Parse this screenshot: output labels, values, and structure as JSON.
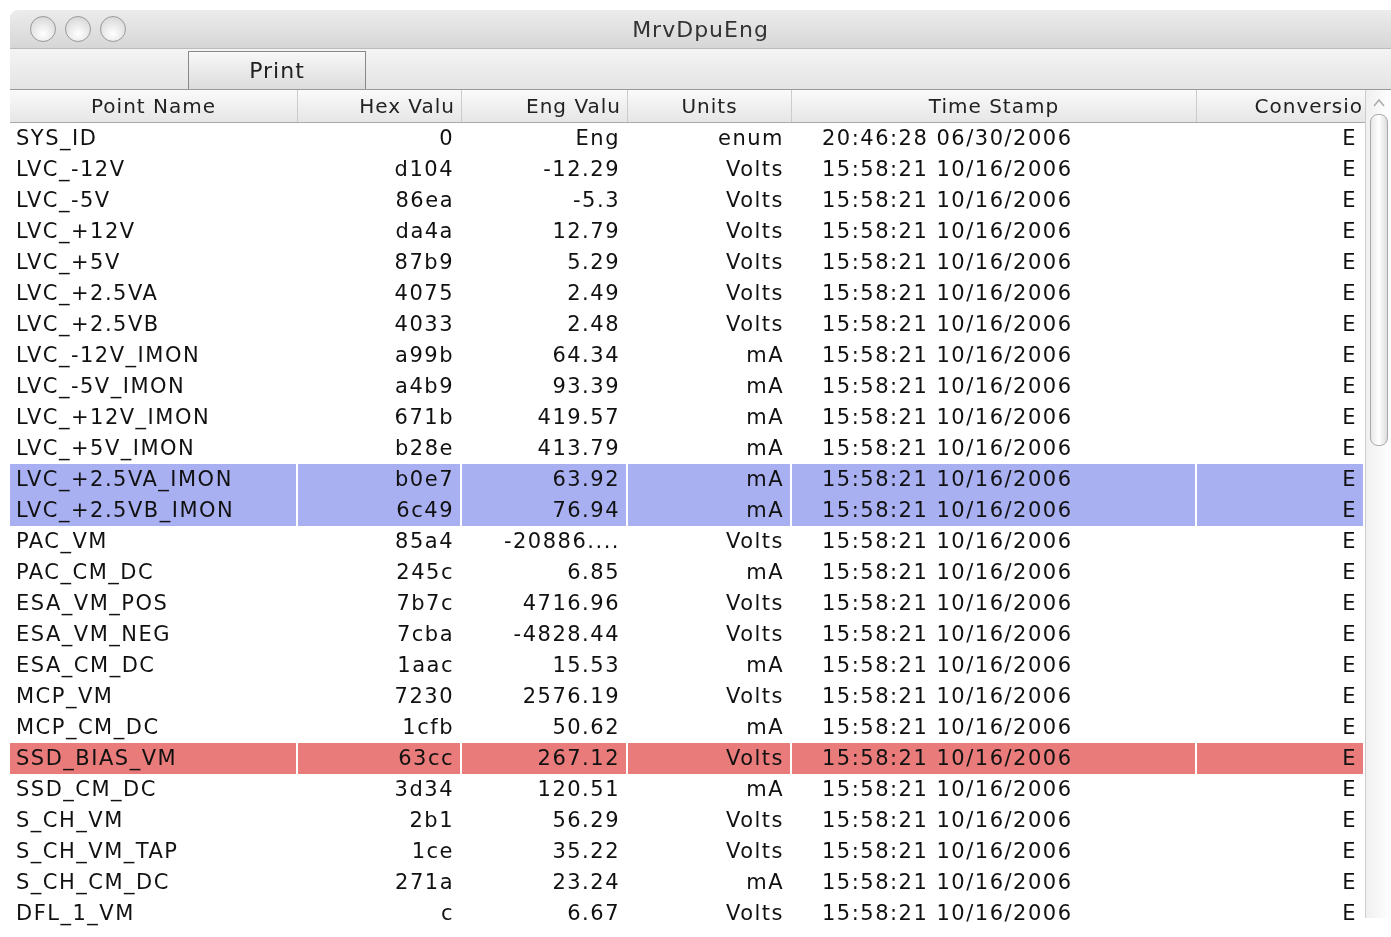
{
  "window": {
    "title": "MrvDpuEng"
  },
  "toolbar": {
    "print_button": "Print"
  },
  "table": {
    "columns": [
      "Point Name",
      "Hex Valu",
      "Eng Valu",
      "Units",
      "Time Stamp",
      "Conversio"
    ],
    "rows": [
      {
        "cells": [
          "SYS_ID",
          "0",
          "Eng",
          "enum",
          "20:46:28 06/30/2006",
          "E"
        ],
        "selected": false,
        "alarm": false
      },
      {
        "cells": [
          "LVC_-12V",
          "d104",
          "-12.29",
          "Volts",
          "15:58:21 10/16/2006",
          "E"
        ],
        "selected": false,
        "alarm": false
      },
      {
        "cells": [
          "LVC_-5V",
          "86ea",
          "-5.3",
          "Volts",
          "15:58:21 10/16/2006",
          "E"
        ],
        "selected": false,
        "alarm": false
      },
      {
        "cells": [
          "LVC_+12V",
          "da4a",
          "12.79",
          "Volts",
          "15:58:21 10/16/2006",
          "E"
        ],
        "selected": false,
        "alarm": false
      },
      {
        "cells": [
          "LVC_+5V",
          "87b9",
          "5.29",
          "Volts",
          "15:58:21 10/16/2006",
          "E"
        ],
        "selected": false,
        "alarm": false
      },
      {
        "cells": [
          "LVC_+2.5VA",
          "4075",
          "2.49",
          "Volts",
          "15:58:21 10/16/2006",
          "E"
        ],
        "selected": false,
        "alarm": false
      },
      {
        "cells": [
          "LVC_+2.5VB",
          "4033",
          "2.48",
          "Volts",
          "15:58:21 10/16/2006",
          "E"
        ],
        "selected": false,
        "alarm": false
      },
      {
        "cells": [
          "LVC_-12V_IMON",
          "a99b",
          "64.34",
          "mA",
          "15:58:21 10/16/2006",
          "E"
        ],
        "selected": false,
        "alarm": false
      },
      {
        "cells": [
          "LVC_-5V_IMON",
          "a4b9",
          "93.39",
          "mA",
          "15:58:21 10/16/2006",
          "E"
        ],
        "selected": false,
        "alarm": false
      },
      {
        "cells": [
          "LVC_+12V_IMON",
          "671b",
          "419.57",
          "mA",
          "15:58:21 10/16/2006",
          "E"
        ],
        "selected": false,
        "alarm": false
      },
      {
        "cells": [
          "LVC_+5V_IMON",
          "b28e",
          "413.79",
          "mA",
          "15:58:21 10/16/2006",
          "E"
        ],
        "selected": false,
        "alarm": false
      },
      {
        "cells": [
          "LVC_+2.5VA_IMON",
          "b0e7",
          "63.92",
          "mA",
          "15:58:21 10/16/2006",
          "E"
        ],
        "selected": true,
        "alarm": false
      },
      {
        "cells": [
          "LVC_+2.5VB_IMON",
          "6c49",
          "76.94",
          "mA",
          "15:58:21 10/16/2006",
          "E"
        ],
        "selected": true,
        "alarm": false
      },
      {
        "cells": [
          "PAC_VM",
          "85a4",
          "-20886....",
          "Volts",
          "15:58:21 10/16/2006",
          "E"
        ],
        "selected": false,
        "alarm": false
      },
      {
        "cells": [
          "PAC_CM_DC",
          "245c",
          "6.85",
          "mA",
          "15:58:21 10/16/2006",
          "E"
        ],
        "selected": false,
        "alarm": false
      },
      {
        "cells": [
          "ESA_VM_POS",
          "7b7c",
          "4716.96",
          "Volts",
          "15:58:21 10/16/2006",
          "E"
        ],
        "selected": false,
        "alarm": false
      },
      {
        "cells": [
          "ESA_VM_NEG",
          "7cba",
          "-4828.44",
          "Volts",
          "15:58:21 10/16/2006",
          "E"
        ],
        "selected": false,
        "alarm": false
      },
      {
        "cells": [
          "ESA_CM_DC",
          "1aac",
          "15.53",
          "mA",
          "15:58:21 10/16/2006",
          "E"
        ],
        "selected": false,
        "alarm": false
      },
      {
        "cells": [
          "MCP_VM",
          "7230",
          "2576.19",
          "Volts",
          "15:58:21 10/16/2006",
          "E"
        ],
        "selected": false,
        "alarm": false
      },
      {
        "cells": [
          "MCP_CM_DC",
          "1cfb",
          "50.62",
          "mA",
          "15:58:21 10/16/2006",
          "E"
        ],
        "selected": false,
        "alarm": false
      },
      {
        "cells": [
          "SSD_BIAS_VM",
          "63cc",
          "267.12",
          "Volts",
          "15:58:21 10/16/2006",
          "E"
        ],
        "selected": false,
        "alarm": true
      },
      {
        "cells": [
          "SSD_CM_DC",
          "3d34",
          "120.51",
          "mA",
          "15:58:21 10/16/2006",
          "E"
        ],
        "selected": false,
        "alarm": false
      },
      {
        "cells": [
          "S_CH_VM",
          "2b1",
          "56.29",
          "Volts",
          "15:58:21 10/16/2006",
          "E"
        ],
        "selected": false,
        "alarm": false
      },
      {
        "cells": [
          "S_CH_VM_TAP",
          "1ce",
          "35.22",
          "Volts",
          "15:58:21 10/16/2006",
          "E"
        ],
        "selected": false,
        "alarm": false
      },
      {
        "cells": [
          "S_CH_CM_DC",
          "271a",
          "23.24",
          "mA",
          "15:58:21 10/16/2006",
          "E"
        ],
        "selected": false,
        "alarm": false
      },
      {
        "cells": [
          "DFL_1_VM",
          "c",
          "6.67",
          "Volts",
          "15:58:21 10/16/2006",
          "E"
        ],
        "selected": false,
        "alarm": false
      }
    ]
  }
}
